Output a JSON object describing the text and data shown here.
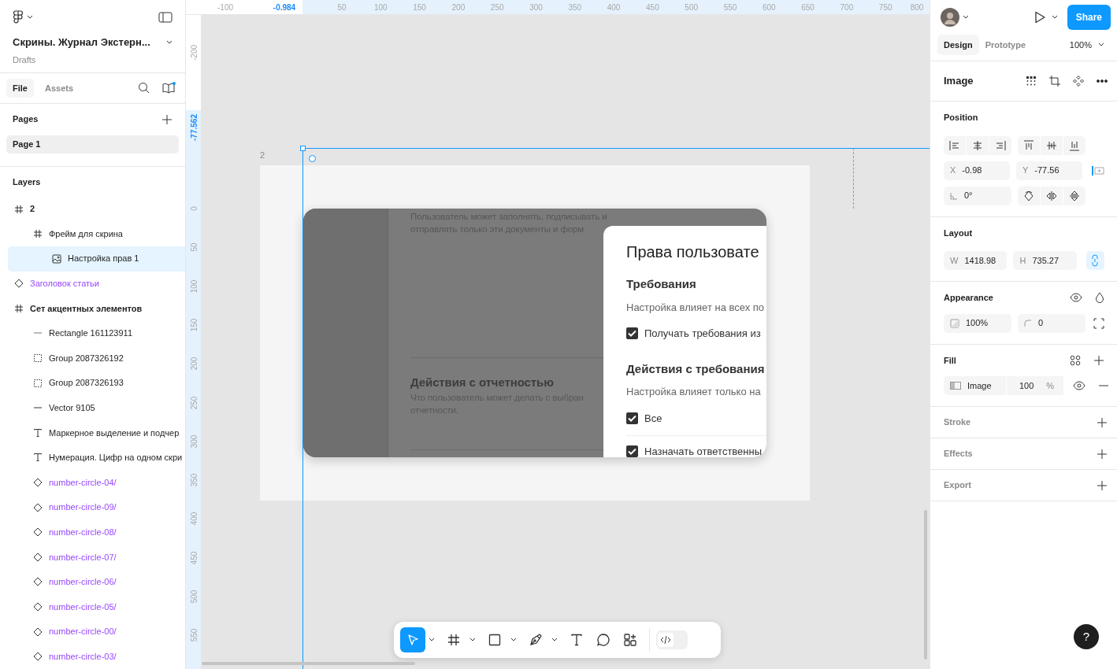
{
  "file": {
    "name": "Скрины. Журнал Экстерн...",
    "location": "Drafts"
  },
  "left_tabs": [
    {
      "label": "File",
      "selected": true
    },
    {
      "label": "Assets",
      "selected": false
    }
  ],
  "pages": {
    "title": "Pages",
    "items": [
      {
        "label": "Page 1",
        "selected": true
      }
    ]
  },
  "layers": {
    "title": "Layers",
    "items": [
      {
        "label": "2",
        "kind": "frame",
        "selected": false,
        "children": [
          {
            "label": "Фрейм для скрина",
            "kind": "frame",
            "selected": false,
            "children": [
              {
                "label": "Настройка прав 1",
                "kind": "image",
                "selected": true
              }
            ]
          }
        ]
      },
      {
        "label": "Заголовок статьи",
        "kind": "component",
        "selected": false
      },
      {
        "label": "Сет акцентных элементов",
        "kind": "frame",
        "selected": false,
        "children": [
          {
            "label": "Rectangle 161123911",
            "kind": "rectangle",
            "selected": false
          },
          {
            "label": "Group 2087326192",
            "kind": "group",
            "selected": false
          },
          {
            "label": "Group 2087326193",
            "kind": "group",
            "selected": false
          },
          {
            "label": "Vector 9105",
            "kind": "vector",
            "selected": false
          },
          {
            "label": "Маркерное выделение и подчер",
            "kind": "text",
            "selected": false
          },
          {
            "label": "Нумерация. Цифр на одном скри",
            "kind": "text",
            "selected": false
          },
          {
            "label": "number-circle-04/",
            "kind": "component",
            "selected": false
          },
          {
            "label": "number-circle-09/",
            "kind": "component",
            "selected": false
          },
          {
            "label": "number-circle-08/",
            "kind": "component",
            "selected": false
          },
          {
            "label": "number-circle-07/",
            "kind": "component",
            "selected": false
          },
          {
            "label": "number-circle-06/",
            "kind": "component",
            "selected": false
          },
          {
            "label": "number-circle-05/",
            "kind": "component",
            "selected": false
          },
          {
            "label": "number-circle-00/",
            "kind": "component",
            "selected": false
          },
          {
            "label": "number-circle-03/",
            "kind": "component",
            "selected": false
          }
        ]
      }
    ]
  },
  "ruler_x": [
    {
      "label": "-100",
      "selected": false
    },
    {
      "label": "-0.984",
      "selected": true
    },
    {
      "label": "50",
      "selected": false
    },
    {
      "label": "100",
      "selected": false
    },
    {
      "label": "150",
      "selected": false
    },
    {
      "label": "200",
      "selected": false
    },
    {
      "label": "250",
      "selected": false
    },
    {
      "label": "300",
      "selected": false
    },
    {
      "label": "350",
      "selected": false
    },
    {
      "label": "400",
      "selected": false
    },
    {
      "label": "450",
      "selected": false
    },
    {
      "label": "500",
      "selected": false
    },
    {
      "label": "550",
      "selected": false
    },
    {
      "label": "600",
      "selected": false
    },
    {
      "label": "650",
      "selected": false
    },
    {
      "label": "700",
      "selected": false
    },
    {
      "label": "750",
      "selected": false
    },
    {
      "label": "800",
      "selected": false
    }
  ],
  "ruler_y": [
    {
      "label": "-200",
      "selected": false
    },
    {
      "label": "-77.562",
      "selected": true
    },
    {
      "label": "0",
      "selected": false
    },
    {
      "label": "50",
      "selected": false
    },
    {
      "label": "100",
      "selected": false
    },
    {
      "label": "150",
      "selected": false
    },
    {
      "label": "200",
      "selected": false
    },
    {
      "label": "250",
      "selected": false
    },
    {
      "label": "300",
      "selected": false
    },
    {
      "label": "350",
      "selected": false
    },
    {
      "label": "400",
      "selected": false
    },
    {
      "label": "450",
      "selected": false
    },
    {
      "label": "500",
      "selected": false
    },
    {
      "label": "550",
      "selected": false
    }
  ],
  "canvas": {
    "frame_label": "2",
    "screenshot": {
      "intro_lines": [
        "Пользователь может заполнять, подписывать и",
        "отправлять только эти документы и форм"
      ],
      "section_title": "Действия с отчетностью",
      "section_lines": [
        "Что пользователь может делать с выбран",
        "отчетности."
      ],
      "modal": {
        "title": "Права пользовате",
        "groups": [
          {
            "heading": "Требования",
            "hint": "Настройка влияет на всех по",
            "options": [
              {
                "label": "Получать требования из",
                "checked": true
              }
            ]
          },
          {
            "heading": "Действия с требования",
            "hint": "Настройка влияет только на",
            "options": [
              {
                "label": "Все",
                "checked": true
              },
              {
                "label": "Назначать ответственны",
                "checked": true
              }
            ]
          }
        ]
      }
    }
  },
  "toolbar": {
    "tools": [
      {
        "kind": "move",
        "selected": true,
        "menu": true
      },
      {
        "kind": "frame",
        "selected": false,
        "menu": true
      },
      {
        "kind": "rectangle",
        "selected": false,
        "menu": true
      },
      {
        "kind": "pen",
        "selected": false,
        "menu": true
      },
      {
        "kind": "text",
        "selected": false,
        "menu": false
      },
      {
        "kind": "comment",
        "selected": false,
        "menu": false
      },
      {
        "kind": "actions",
        "selected": false,
        "menu": false
      }
    ],
    "dev_mode": false
  },
  "right_panel": {
    "share": "Share",
    "tabs": [
      {
        "label": "Design",
        "selected": true
      },
      {
        "label": "Prototype",
        "selected": false
      }
    ],
    "zoom": "100%",
    "selection_title": "Image",
    "position": {
      "title": "Position",
      "x": {
        "label": "X",
        "value": "-0.98"
      },
      "y": {
        "label": "Y",
        "value": "-77.56"
      },
      "rotation": "0°"
    },
    "layout": {
      "title": "Layout",
      "w": {
        "label": "W",
        "value": "1418.98"
      },
      "h": {
        "label": "H",
        "value": "735.27"
      },
      "ratio_locked": true
    },
    "appearance": {
      "title": "Appearance",
      "opacity": "100%",
      "radius": "0"
    },
    "fill": {
      "title": "Fill",
      "type": "Image",
      "opacity": "100",
      "unit": "%"
    },
    "empty_sections": [
      "Stroke",
      "Effects",
      "Export"
    ]
  },
  "help": "?"
}
